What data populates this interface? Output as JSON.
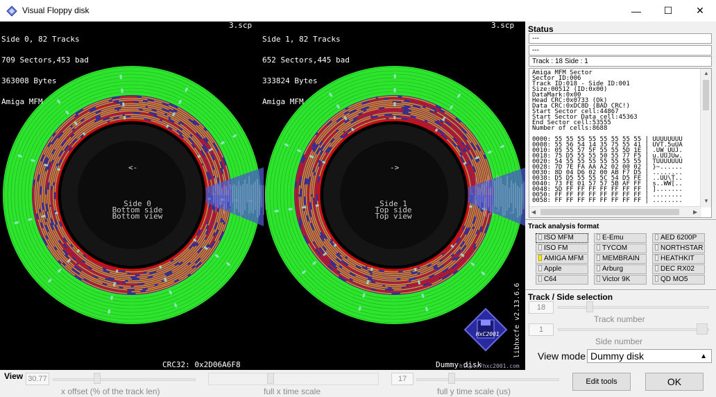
{
  "window": {
    "title": "Visual Floppy disk",
    "minimize_glyph": "—",
    "maximize_glyph": "☐",
    "close_glyph": "✕"
  },
  "viewer": {
    "left_header": [
      "Side 0, 82 Tracks",
      "709 Sectors,453 bad",
      "363008 Bytes",
      "Amiga MFM"
    ],
    "left_file": "3.scp",
    "right_header": [
      "Side 1, 82 Tracks",
      "652 Sectors,445 bad",
      "333824 Bytes",
      "Amiga MFM"
    ],
    "right_file": "3.scp",
    "left_center": [
      "<-",
      "Side 0",
      "Bottom side",
      "Bottom view"
    ],
    "right_center": [
      "->",
      "Side 1",
      "Top side",
      "Top view"
    ],
    "crc": "CRC32: 0x2D06A6F8",
    "dummy": "Dummy disk",
    "version": "libhxcfe v2.13.6.6",
    "logo_text": "HxC2001",
    "url": "http://hxc2001.com",
    "colors": {
      "ok_sector": "#e8841c",
      "bad_sector": "#e01010",
      "unformatted": "#2ee52e",
      "gap": "#3a2f8a",
      "hub_ring": "#d01010"
    }
  },
  "status": {
    "title": "Status",
    "field1": "---",
    "field2": "---",
    "track_side": "Track : 18 Side : 1",
    "info_lines": [
      "Amiga MFM Sector",
      "Sector ID:006",
      "Track ID:018 - Side ID:001",
      "Size:00512 (ID:0x00)",
      "DataMark:0x00",
      "Head CRC:0x0733 (Ok)",
      "Data CRC:0xDC8D (BAD CRC!)",
      "Start Sector cell:44867",
      "Start Sector Data cell:45363",
      "End Sector cell:53555",
      "Number of cells:8688",
      "",
      "0000: 55 55 55 55 55 55 55 55 | UUUUUUUU",
      "0008: 55 56 54 14 35 75 55 41 | UVT.5uUA",
      "0010: 05 55 57 5F 55 55 5D 1E | .UW_UUJ.",
      "0018: 75 D5 55 55 50 55 77 F5 | u.UUJUw.",
      "0020: 54 55 55 55 55 55 55 55 | TUUUUUUU",
      "0028: 7D 7E FA AA A2 02 00 02 | }~......",
      "0030: 8D 04 D6 02 00 AB F7 D5 | ........",
      "0038: D5 D5 55 55 5C 54 D5 FE | ..UU\\T..",
      "0040: 73 FE 01 57 57 5B AF FF | s..WW[..",
      "0048: 5D FF FF FF FF FF FF FF | ].......",
      "0050: FF FF FF FF FF FF FF FF | ........",
      "0058: FF FF FF FF FF FF FF FF | ........"
    ]
  },
  "analysis": {
    "title": "Track analysis format",
    "formats": [
      {
        "label": "ISO MFM",
        "active": false,
        "selected": true
      },
      {
        "label": "E-Emu",
        "active": false,
        "selected": false
      },
      {
        "label": "AED 6200P",
        "active": false,
        "selected": false
      },
      {
        "label": "ISO FM",
        "active": false,
        "selected": false
      },
      {
        "label": "TYCOM",
        "active": false,
        "selected": false
      },
      {
        "label": "NORTHSTAR",
        "active": false,
        "selected": false
      },
      {
        "label": "AMIGA MFM",
        "active": true,
        "selected": false
      },
      {
        "label": "MEMBRAIN",
        "active": false,
        "selected": false
      },
      {
        "label": "HEATHKIT",
        "active": false,
        "selected": false
      },
      {
        "label": "Apple",
        "active": false,
        "selected": false
      },
      {
        "label": "Arburg",
        "active": false,
        "selected": false
      },
      {
        "label": "DEC RX02",
        "active": false,
        "selected": false
      },
      {
        "label": "C64",
        "active": false,
        "selected": false
      },
      {
        "label": "Victor 9K",
        "active": false,
        "selected": false
      },
      {
        "label": "QD MO5",
        "active": false,
        "selected": false
      }
    ]
  },
  "track_side": {
    "title": "Track / Side selection",
    "track_value": "18",
    "track_label": "Track number",
    "side_value": "1",
    "side_label": "Side number",
    "view_mode_label": "View mode",
    "view_mode_value": "Dummy disk"
  },
  "bottom": {
    "view_label": "View",
    "x_offset_value": "30.77",
    "x_offset_label": "x offset (% of the track len)",
    "x_time_label": "full x time scale",
    "y_time_value": "17",
    "y_time_label": "full y time scale (us)",
    "edit_tools": "Edit tools",
    "ok": "OK"
  }
}
